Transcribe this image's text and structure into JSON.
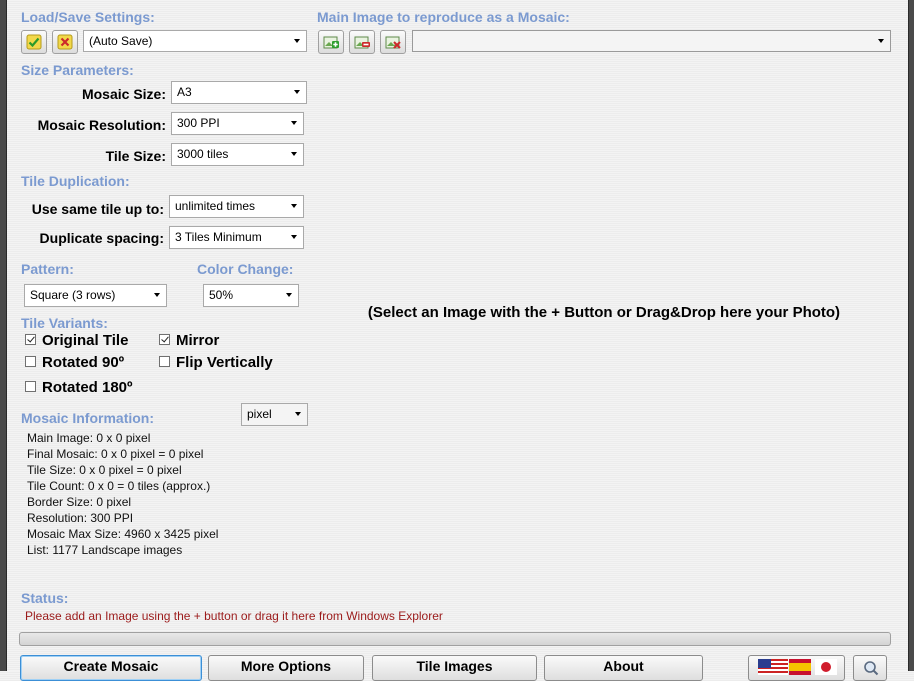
{
  "load_save": {
    "title": "Load/Save Settings:",
    "settings_value": "(Auto Save)"
  },
  "main_image": {
    "title": "Main Image to reproduce as a Mosaic:",
    "selected_value": "",
    "placeholder": "(Select an Image with the + Button or Drag&Drop here your Photo)"
  },
  "size_params": {
    "title": "Size Parameters:",
    "mosaic_size_label": "Mosaic Size:",
    "mosaic_size_value": "A3",
    "resolution_label": "Mosaic Resolution:",
    "resolution_value": "300 PPI",
    "tile_size_label": "Tile Size:",
    "tile_size_value": "3000 tiles"
  },
  "duplication": {
    "title": "Tile Duplication:",
    "same_tile_label": "Use same tile up to:",
    "same_tile_value": "unlimited times",
    "spacing_label": "Duplicate spacing:",
    "spacing_value": "3 Tiles Minimum"
  },
  "pattern": {
    "title": "Pattern:",
    "value": "Square (3 rows)"
  },
  "color_change": {
    "title": "Color Change:",
    "value": "50%"
  },
  "variants": {
    "title": "Tile Variants:",
    "items": [
      {
        "label": "Original Tile",
        "checked": true
      },
      {
        "label": "Mirror",
        "checked": true
      },
      {
        "label": "Rotated 90º",
        "checked": false
      },
      {
        "label": "Flip Vertically",
        "checked": false
      },
      {
        "label": "Rotated 180º",
        "checked": false
      }
    ]
  },
  "info": {
    "title": "Mosaic Information:",
    "unit_value": "pixel",
    "lines": [
      "Main Image: 0 x 0 pixel",
      "Final Mosaic: 0 x 0 pixel = 0 pixel",
      "Tile Size: 0 x 0 pixel = 0 pixel",
      "Tile Count: 0 x 0 = 0 tiles (approx.)",
      "Border Size: 0 pixel",
      "Resolution: 300 PPI",
      "Mosaic Max Size: 4960 x 3425 pixel",
      "List: 1177 Landscape images"
    ]
  },
  "status": {
    "title": "Status:",
    "message": "Please add an Image using the + button or drag it here from Windows Explorer",
    "progress": 0
  },
  "buttons": {
    "create": "Create Mosaic",
    "more_options": "More Options",
    "tile_images": "Tile Images",
    "about": "About"
  },
  "colors": {
    "section_title": "#7b9ad0",
    "status_message": "#9b1a1a"
  }
}
